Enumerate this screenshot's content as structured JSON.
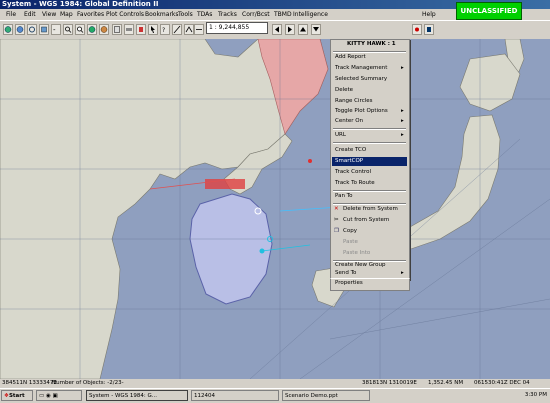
{
  "window": {
    "title": "System - WGS 1984: Global Definition II"
  },
  "menu": [
    "File",
    "Edit",
    "View",
    "Map",
    "Favorites",
    "Plot Controls",
    "Bookmarks",
    "Tools",
    "TDAs",
    "Tracks",
    "Corr/Bcst",
    "TBMD",
    "Intelligence",
    "Help"
  ],
  "toolbar": {
    "scale": "1 : 9,244,855"
  },
  "classification": "UNCLASSIFIED",
  "context_menu": {
    "header": "KITTY HAWK : 1",
    "items": [
      {
        "label": "Add Report",
        "submenu": false,
        "disabled": false
      },
      {
        "label": "Track Management",
        "submenu": true,
        "disabled": false
      },
      {
        "label": "Selected Summary",
        "submenu": false,
        "disabled": false
      },
      {
        "label": "Delete",
        "submenu": false,
        "disabled": false
      },
      {
        "label": "Range Circles",
        "submenu": false,
        "disabled": false
      },
      {
        "label": "Toggle Plot Options",
        "submenu": true,
        "disabled": false
      },
      {
        "label": "Center On",
        "submenu": true,
        "disabled": false
      },
      {
        "label": "URL",
        "submenu": true,
        "disabled": false
      },
      {
        "label": "Create TCO",
        "submenu": false,
        "disabled": false
      },
      {
        "label": "SmartCOP",
        "submenu": false,
        "disabled": false,
        "highlighted": true
      },
      {
        "label": "Track Control",
        "submenu": false,
        "disabled": false
      },
      {
        "label": "Track To Route",
        "submenu": false,
        "disabled": false
      },
      {
        "label": "Pan To",
        "submenu": false,
        "disabled": false
      },
      {
        "label": "Delete from System",
        "submenu": false,
        "disabled": false
      },
      {
        "label": "Cut from System",
        "submenu": false,
        "disabled": false
      },
      {
        "label": "Copy",
        "submenu": false,
        "disabled": false
      },
      {
        "label": "Paste",
        "submenu": false,
        "disabled": true
      },
      {
        "label": "Paste Into",
        "submenu": false,
        "disabled": true
      },
      {
        "label": "Create New Group",
        "submenu": false,
        "disabled": false
      },
      {
        "label": "Send To",
        "submenu": true,
        "disabled": false
      },
      {
        "label": "Properties",
        "submenu": false,
        "disabled": false
      }
    ]
  },
  "status": {
    "coords": "384511N 1333347E",
    "objects": "Number of Objects: -2/23-",
    "position": "381813N 1310019E",
    "range": "1,352.45 NM",
    "time": "061530:41Z DEC 04"
  },
  "taskbar": {
    "start": "Start",
    "tasks": [
      "System - WGS 1984: G...",
      "112404",
      "Scenario Demo.ppt"
    ],
    "clock": "3:30 PM"
  },
  "colors": {
    "sea": "#8f9fbf",
    "land": "#d8d8cc",
    "highlight": "#0a246a",
    "classification": "#00d000"
  }
}
